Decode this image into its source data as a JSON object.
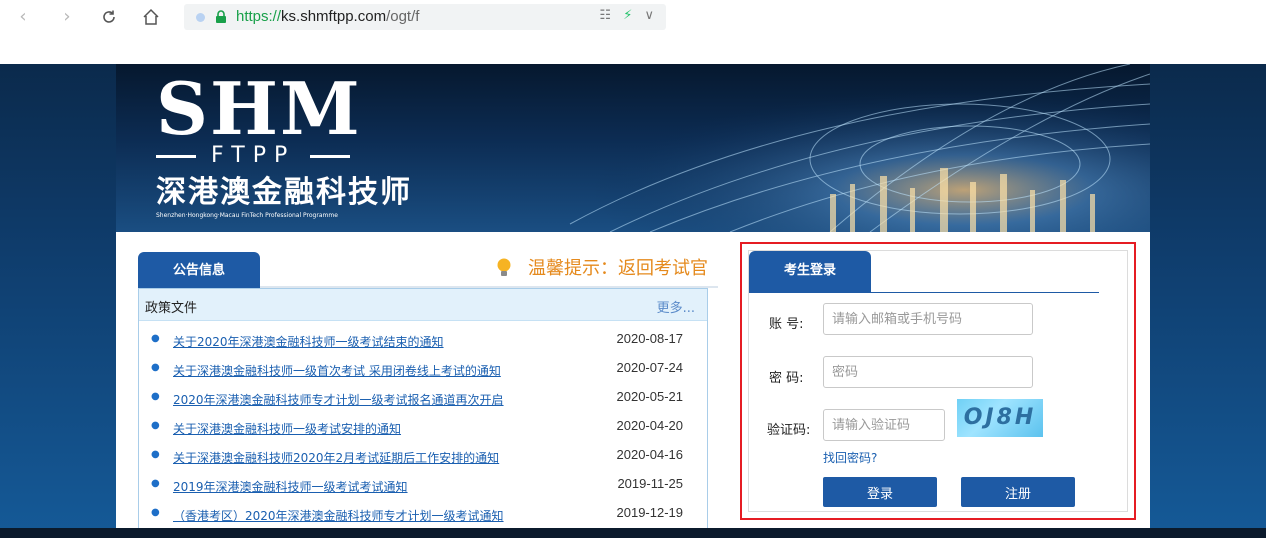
{
  "browser": {
    "url_scheme": "https://",
    "url_host": "ks.shmftpp.com",
    "url_path": "/ogt/f",
    "icons": [
      "back-icon",
      "forward-icon",
      "reload-icon",
      "home-icon",
      "qr-icon",
      "bolt-icon",
      "chevron-down-icon"
    ]
  },
  "banner": {
    "logo_main": "SHM",
    "logo_sub": "FTPP",
    "logo_cn": "深港澳金融科技师",
    "logo_en": "Shenzhen·Hongkong·Macau FinTech Professional Programme"
  },
  "notice": {
    "tab_label": "公告信息",
    "tip_text": "温馨提示：返回考试官",
    "list_title": "政策文件",
    "more_label": "更多...",
    "items": [
      {
        "title": "关于2020年深港澳金融科技师一级考试结束的通知",
        "date": "2020-08-17"
      },
      {
        "title": "关于深港澳金融科技师一级首次考试 采用闭卷线上考试的通知",
        "date": "2020-07-24"
      },
      {
        "title": "2020年深港澳金融科技师专才计划一级考试报名通道再次开启",
        "date": "2020-05-21"
      },
      {
        "title": "关于深港澳金融科技师一级考试安排的通知",
        "date": "2020-04-20"
      },
      {
        "title": "关于深港澳金融科技师2020年2月考试延期后工作安排的通知",
        "date": "2020-04-16"
      },
      {
        "title": "2019年深港澳金融科技师一级考试考试通知",
        "date": "2019-11-25"
      },
      {
        "title": "（香港考区）2020年深港澳金融科技师专才计划一级考试通知",
        "date": "2019-12-19"
      }
    ]
  },
  "login": {
    "tab_label": "考生登录",
    "account_label": "账  号:",
    "account_placeholder": "请输入邮箱或手机号码",
    "password_label": "密  码:",
    "password_placeholder": "密码",
    "captcha_label": "验证码:",
    "captcha_placeholder": "请输入验证码",
    "captcha_text": "OJ8H",
    "forgot_label": "找回密码?",
    "login_button": "登录",
    "register_button": "注册"
  },
  "colors": {
    "primary": "#1e5aa5",
    "highlight_border": "#e51c23",
    "tip": "#e58a1d",
    "link": "#1a5fb0"
  }
}
